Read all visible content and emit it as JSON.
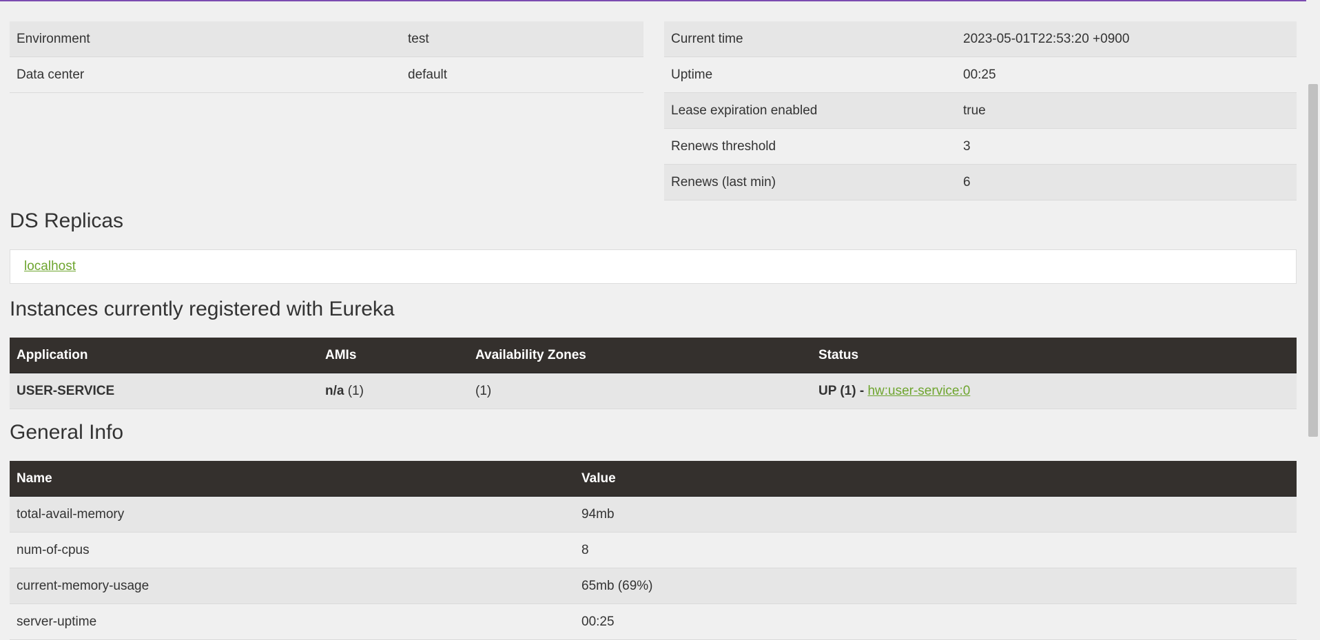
{
  "system_status": {
    "left": [
      {
        "label": "Environment",
        "value": "test"
      },
      {
        "label": "Data center",
        "value": "default"
      }
    ],
    "right": [
      {
        "label": "Current time",
        "value": "2023-05-01T22:53:20 +0900"
      },
      {
        "label": "Uptime",
        "value": "00:25"
      },
      {
        "label": "Lease expiration enabled",
        "value": "true"
      },
      {
        "label": "Renews threshold",
        "value": "3"
      },
      {
        "label": "Renews (last min)",
        "value": "6"
      }
    ]
  },
  "ds_replicas": {
    "heading": "DS Replicas",
    "items": [
      "localhost"
    ]
  },
  "instances": {
    "heading": "Instances currently registered with Eureka",
    "columns": [
      "Application",
      "AMIs",
      "Availability Zones",
      "Status"
    ],
    "rows": [
      {
        "application": "USER-SERVICE",
        "ami_name": "n/a",
        "ami_count": "(1)",
        "zones": "(1)",
        "status_prefix": "UP (1) -",
        "status_link": "hw:user-service:0"
      }
    ]
  },
  "general_info": {
    "heading": "General Info",
    "columns": [
      "Name",
      "Value"
    ],
    "rows": [
      {
        "name": "total-avail-memory",
        "value": "94mb"
      },
      {
        "name": "num-of-cpus",
        "value": "8"
      },
      {
        "name": "current-memory-usage",
        "value": "65mb (69%)"
      },
      {
        "name": "server-uptime",
        "value": "00:25"
      }
    ]
  },
  "colors": {
    "accent_link": "#6ea52f",
    "table_header_bg": "#34302d",
    "top_border": "#7b4bb0"
  }
}
